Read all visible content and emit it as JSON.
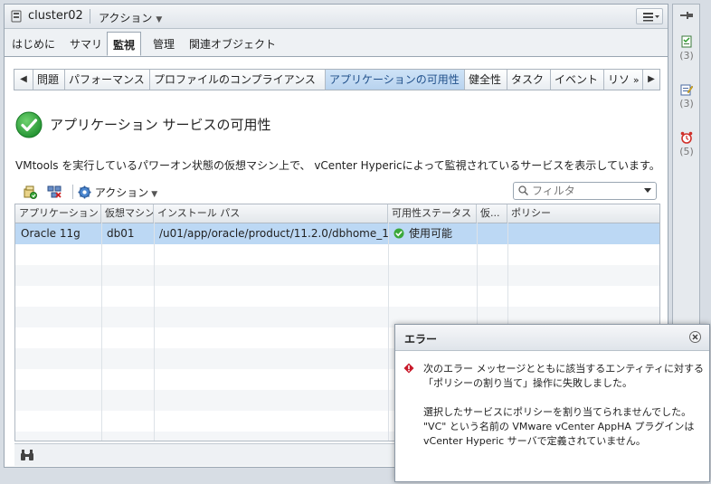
{
  "window": {
    "title": "cluster02",
    "actions_label": "アクション"
  },
  "tabs": [
    {
      "label": "はじめに",
      "active": false
    },
    {
      "label": "サマリ",
      "active": false
    },
    {
      "label": "監視",
      "active": true
    },
    {
      "label": "管理",
      "active": false
    },
    {
      "label": "関連オブジェクト",
      "active": false
    }
  ],
  "subtabs": [
    {
      "label": "問題"
    },
    {
      "label": "パフォーマンス"
    },
    {
      "label": "プロファイルのコンプライアンス"
    },
    {
      "label": "アプリケーションの可用性",
      "active": true
    },
    {
      "label": "健全性"
    },
    {
      "label": "タスク"
    },
    {
      "label": "イベント"
    },
    {
      "label": "リソ"
    }
  ],
  "subtab_more_glyph": "»",
  "page": {
    "heading": "アプリケーション サービスの可用性",
    "description": "VMtools を実行しているパワーオン状態の仮想マシン上で、 vCenter Hypericによって監視されているサービスを表示しています。"
  },
  "toolbar": {
    "actions_label": "アクション",
    "filter_placeholder": "フィルタ"
  },
  "table": {
    "columns": [
      "アプリケーション ...",
      "仮想マシン",
      "インストール パス",
      "可用性ステータス",
      "仮...",
      "ポリシー"
    ],
    "rows": [
      {
        "application": "Oracle 11g",
        "vm": "db01",
        "path": "/u01/app/oracle/product/11.2.0/dbhome_1",
        "status": "使用可能",
        "status_color": "#3aa83a",
        "extra": "",
        "policy": ""
      }
    ]
  },
  "right_panel": [
    {
      "icon": "tasks-icon",
      "count": "(3)"
    },
    {
      "icon": "work-in-progress-icon",
      "count": "(3)"
    },
    {
      "icon": "alarm-icon",
      "count": "(5)"
    }
  ],
  "error_dialog": {
    "title": "エラー",
    "lines1": [
      "次のエラー メッセージとともに該当するエンティティに対する",
      "「ポリシーの割り当て」操作に失敗しました。"
    ],
    "lines2": [
      "選択したサービスにポリシーを割り当てられませんでした。",
      "\"VC\" という名前の VMware vCenter AppHA プラグインは",
      "vCenter Hyperic サーバで定義されていません。"
    ]
  },
  "colors": {
    "accent": "#1f6fbf",
    "selected_row": "#bcd8f4",
    "ok_green": "#3aa83a",
    "error_red": "#c8192a"
  }
}
